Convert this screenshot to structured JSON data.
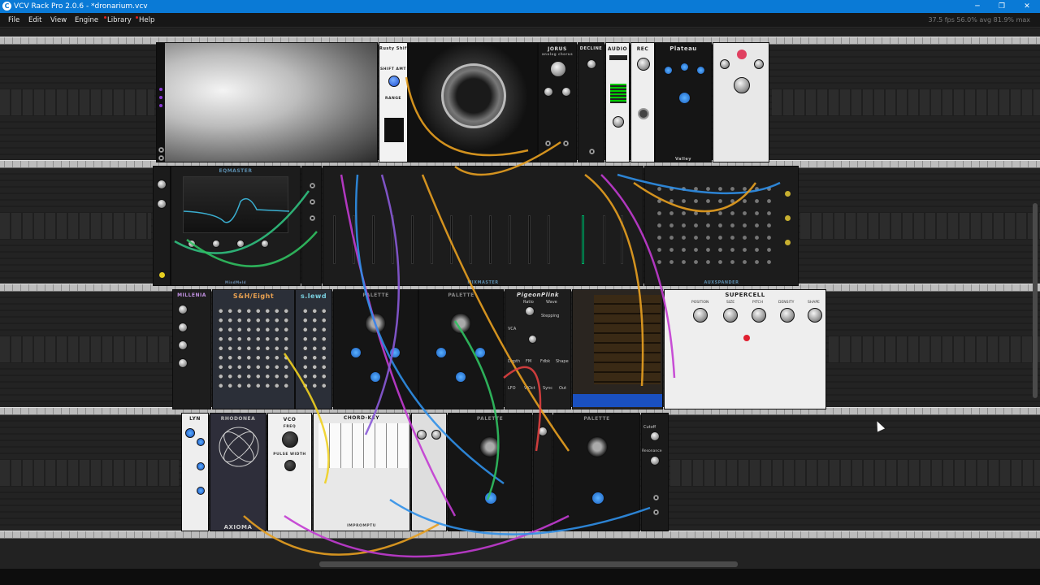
{
  "window": {
    "title": "VCV Rack Pro 2.0.6 - *dronarium.vcv",
    "app_icon": "C",
    "minimize": "─",
    "restore": "❐",
    "close": "✕"
  },
  "menubar": {
    "items": [
      {
        "label": "File",
        "dot": false
      },
      {
        "label": "Edit",
        "dot": false
      },
      {
        "label": "View",
        "dot": false
      },
      {
        "label": "Engine",
        "dot": false
      },
      {
        "label": "Library",
        "dot": true
      },
      {
        "label": "Help",
        "dot": true
      }
    ],
    "stats": "37.5 fps  56.0% avg  81.9% max"
  },
  "modules": {
    "row1": {
      "rusty_shifter": "Rusty Shifter",
      "shift_amt": "SHIFT AMT",
      "range": "RANGE",
      "jorus": "JORUS",
      "jorus_sub": "analog chorus",
      "decline": "DECLINE",
      "audio": "AUDIO",
      "rec": "REC",
      "plateau": "Plateau",
      "valley": "Valley"
    },
    "row2": {
      "eqmaster": "EQMASTER",
      "mixmaster": "MIXMASTER",
      "auxspander": "AUXSPANDER",
      "mindmeld": "MindMeld"
    },
    "row3": {
      "millenium": "MILLENIA",
      "sh_eight": "S&H/Eight",
      "lewd": "s.lewd",
      "palette": "PALETTE",
      "palette2": "PALETTE",
      "pigeon": "PigeonPlink",
      "ratio": "Ratio",
      "wave": "Wave",
      "stepping": "Stepping",
      "vca": "VCA",
      "depth": "Depth",
      "fm": "FM",
      "fdbk": "Fdbk",
      "shape": "Shape",
      "lfo": "LFO",
      "voct": "V/Oct",
      "sync": "Sync",
      "out": "Out",
      "supercell": "SUPERCELL",
      "position": "POSITION",
      "size": "SIZE",
      "pitch": "PITCH",
      "density": "DENSITY",
      "shape2": "SHAPE"
    },
    "row4": {
      "lyn": "LYN",
      "rhodonea": "RHODONEA",
      "axioma": "AXIOMA",
      "vco": "VCO",
      "freq": "FREQ",
      "pulse_width": "PULSE WIDTH",
      "chord_key": "CHORD-KEY",
      "impromptu": "IMPROMPTU",
      "palette3": "PALETTE",
      "palette4": "PALETTE",
      "cutoff": "Cutoff",
      "resonance": "Resonance"
    }
  },
  "colors": {
    "titlebar": "#0a7ad6",
    "menubar": "#171717",
    "rack_bg": "#222222",
    "cable_colors": [
      "#e8a020",
      "#c23bd1",
      "#2f8fe8",
      "#30c060",
      "#f0d020",
      "#e04040",
      "#8a5ad8"
    ]
  }
}
